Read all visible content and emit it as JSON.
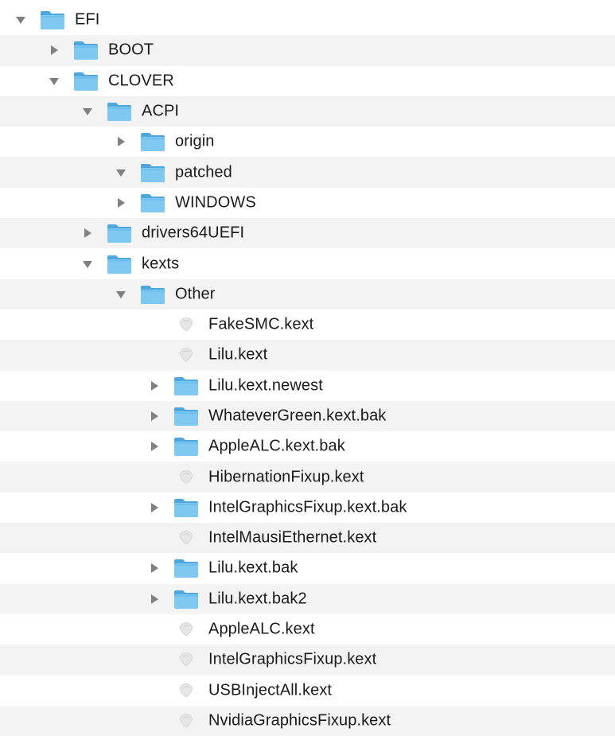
{
  "tree": [
    {
      "label": "EFI",
      "type": "folder",
      "depth": 0,
      "state": "expanded"
    },
    {
      "label": "BOOT",
      "type": "folder",
      "depth": 1,
      "state": "collapsed"
    },
    {
      "label": "CLOVER",
      "type": "folder",
      "depth": 1,
      "state": "expanded"
    },
    {
      "label": "ACPI",
      "type": "folder",
      "depth": 2,
      "state": "expanded"
    },
    {
      "label": "origin",
      "type": "folder",
      "depth": 3,
      "state": "collapsed"
    },
    {
      "label": "patched",
      "type": "folder",
      "depth": 3,
      "state": "expanded"
    },
    {
      "label": "WINDOWS",
      "type": "folder",
      "depth": 3,
      "state": "collapsed"
    },
    {
      "label": "drivers64UEFI",
      "type": "folder",
      "depth": 2,
      "state": "collapsed"
    },
    {
      "label": "kexts",
      "type": "folder",
      "depth": 2,
      "state": "expanded"
    },
    {
      "label": "Other",
      "type": "folder",
      "depth": 3,
      "state": "expanded"
    },
    {
      "label": "FakeSMC.kext",
      "type": "kext",
      "depth": 4,
      "state": "none"
    },
    {
      "label": "Lilu.kext",
      "type": "kext",
      "depth": 4,
      "state": "none"
    },
    {
      "label": "Lilu.kext.newest",
      "type": "folder",
      "depth": 4,
      "state": "collapsed"
    },
    {
      "label": "WhateverGreen.kext.bak",
      "type": "folder",
      "depth": 4,
      "state": "collapsed"
    },
    {
      "label": "AppleALC.kext.bak",
      "type": "folder",
      "depth": 4,
      "state": "collapsed"
    },
    {
      "label": "HibernationFixup.kext",
      "type": "kext",
      "depth": 4,
      "state": "none"
    },
    {
      "label": "IntelGraphicsFixup.kext.bak",
      "type": "folder",
      "depth": 4,
      "state": "collapsed"
    },
    {
      "label": "IntelMausiEthernet.kext",
      "type": "kext",
      "depth": 4,
      "state": "none"
    },
    {
      "label": "Lilu.kext.bak",
      "type": "folder",
      "depth": 4,
      "state": "collapsed"
    },
    {
      "label": "Lilu.kext.bak2",
      "type": "folder",
      "depth": 4,
      "state": "collapsed"
    },
    {
      "label": "AppleALC.kext",
      "type": "kext",
      "depth": 4,
      "state": "none"
    },
    {
      "label": "IntelGraphicsFixup.kext",
      "type": "kext",
      "depth": 4,
      "state": "none"
    },
    {
      "label": "USBInjectAll.kext",
      "type": "kext",
      "depth": 4,
      "state": "none"
    },
    {
      "label": "NvidiaGraphicsFixup.kext",
      "type": "kext",
      "depth": 4,
      "state": "none"
    }
  ],
  "icons": {
    "folder": "folder-icon",
    "kext": "kext-bundle-icon",
    "expanded": "disclosure-triangle-down-icon",
    "collapsed": "disclosure-triangle-right-icon"
  },
  "colors": {
    "folder_body": "#5fb8ec",
    "folder_tab": "#4ea6dd",
    "folder_front": "#7ec8f2",
    "disclosure": "#808080",
    "alt_row": "#f3f3f3",
    "kext_icon": "#e6e6e6"
  }
}
